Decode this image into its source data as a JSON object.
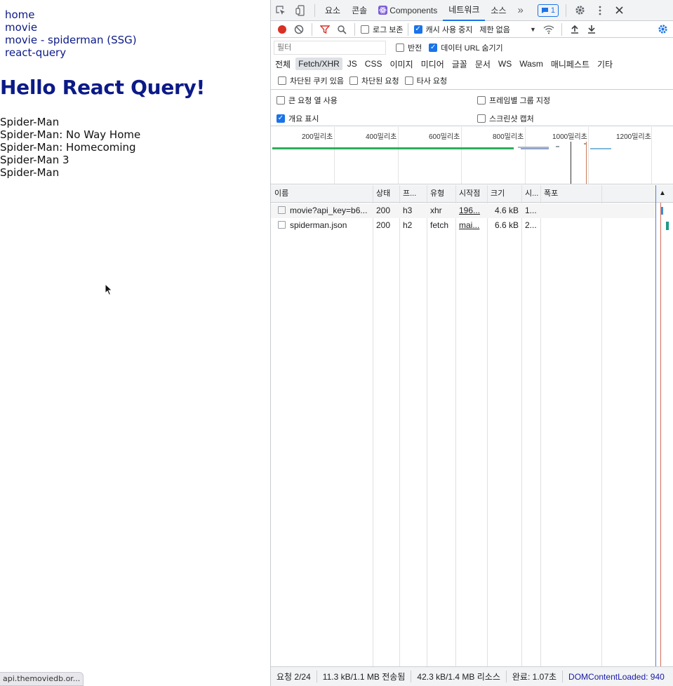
{
  "page": {
    "nav_links": [
      "home",
      "movie",
      "movie - spiderman (SSG)",
      "react-query"
    ],
    "heading": "Hello React Query!",
    "movies": [
      "Spider-Man",
      "Spider-Man: No Way Home",
      "Spider-Man: Homecoming",
      "Spider-Man 3",
      "Spider-Man"
    ],
    "status_url": "api.themoviedb.or..."
  },
  "devtools": {
    "tabs": [
      "요소",
      "콘솔",
      "Components",
      "네트워크",
      "소스"
    ],
    "active_tab": "네트워크",
    "more_tabs": "»",
    "issues_badge": "1",
    "toolbar": {
      "preserve_log": "로그 보존",
      "disable_cache": "캐시 사용 중지",
      "throttling": "제한 없음"
    },
    "filter": {
      "placeholder": "필터",
      "invert": "반전",
      "hide_data_urls": "데이터 URL 숨기기"
    },
    "type_filters": [
      "전체",
      "Fetch/XHR",
      "JS",
      "CSS",
      "이미지",
      "미디어",
      "글꼴",
      "문서",
      "WS",
      "Wasm",
      "매니페스트",
      "기타"
    ],
    "selected_type": "Fetch/XHR",
    "block_filters": [
      "차단된 쿠키 있음",
      "차단된 요청",
      "타사 요청"
    ],
    "options": {
      "large_rows": "큰 요청 열 사용",
      "group_by_frame": "프레임별 그룹 지정",
      "show_overview": "개요 표시",
      "capture_screenshots": "스크린샷 캡처"
    },
    "overview_ticks": [
      "200밀리초",
      "400밀리초",
      "600밀리초",
      "800밀리초",
      "1000밀리초",
      "1200밀리초"
    ],
    "columns": [
      "이름",
      "상태",
      "프...",
      "유형",
      "시작점",
      "크기",
      "시...",
      "폭포"
    ],
    "sort_icon": "▲",
    "requests": [
      {
        "name": "movie?api_key=b6...",
        "status": "200",
        "protocol": "h3",
        "type": "xhr",
        "initiator": "196...",
        "size": "4.6 kB",
        "time": "1..."
      },
      {
        "name": "spiderman.json",
        "status": "200",
        "protocol": "h2",
        "type": "fetch",
        "initiator": "mai...",
        "size": "6.6 kB",
        "time": "2..."
      }
    ],
    "footer": {
      "requests": "요청 2/24",
      "transferred": "11.3 kB/1.1 MB 전송됨",
      "resources": "42.3 kB/1.4 MB 리소스",
      "finish": "완료: 1.07초",
      "dom_content_loaded": "DOMContentLoaded: 940"
    }
  },
  "colors": {
    "link": "#0b1a87",
    "accent": "#1a73e8",
    "record": "#d93025",
    "filter_icon": "#d93025",
    "dcl": "#1a1aa6"
  }
}
